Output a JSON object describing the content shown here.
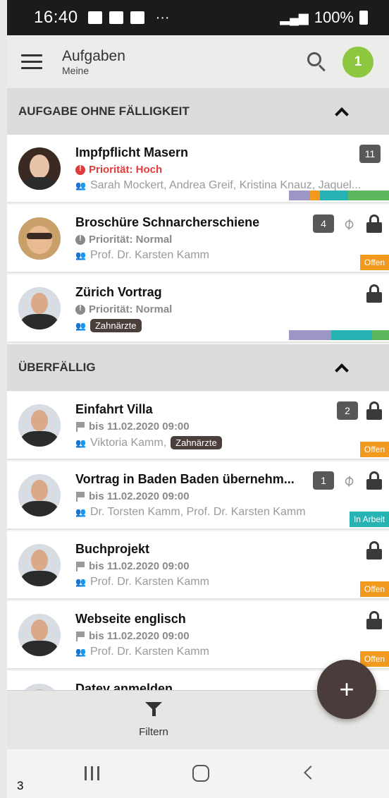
{
  "statusbar": {
    "time": "16:40",
    "dots": "···",
    "battery": "100%"
  },
  "appbar": {
    "title": "Aufgaben",
    "subtitle": "Meine",
    "user_badge": "1"
  },
  "sections": [
    {
      "title": "AUFGABE OHNE FÄLLIGKEIT"
    },
    {
      "title": "ÜBERFÄLLIG"
    }
  ],
  "tasks": [
    {
      "name": "Impfpflicht Masern",
      "meta": "Priorität: Hoch",
      "people": "Sarah Mockert, Andrea Greif, Kristina Knauz, Jaquel...",
      "count": "11"
    },
    {
      "name": "Broschüre Schnarcherschiene",
      "meta": "Priorität: Normal",
      "people": "Prof. Dr. Karsten Kamm",
      "count": "4",
      "status": "Offen"
    },
    {
      "name": "Zürich Vortrag",
      "meta": "Priorität: Normal",
      "tag": "Zahnärzte"
    },
    {
      "name": "Einfahrt Villa",
      "meta": "bis 11.02.2020 09:00",
      "people": "Viktoria Kamm,",
      "tag": "Zahnärzte",
      "count": "2",
      "status": "Offen"
    },
    {
      "name": "Vortrag in Baden Baden übernehm...",
      "meta": "bis 11.02.2020 09:00",
      "people": "Dr. Torsten Kamm, Prof. Dr. Karsten Kamm",
      "count": "1",
      "status": "In Arbeit"
    },
    {
      "name": "Buchprojekt",
      "meta": "bis 11.02.2020 09:00",
      "people": "Prof. Dr. Karsten Kamm",
      "status": "Offen"
    },
    {
      "name": "Webseite englisch",
      "meta": "bis 11.02.2020 09:00",
      "people": "Prof. Dr. Karsten Kamm",
      "status": "Offen"
    },
    {
      "name": "Datev anmelden"
    }
  ],
  "filter": {
    "label": "Filtern"
  },
  "fab": {
    "label": "+"
  },
  "page_number": "3",
  "colors": {
    "accent_green": "#8dc63f",
    "status_open": "#f29a1d",
    "status_work": "#27b3b3",
    "fab": "#4a3c3a",
    "priority_high": "#e23b3b"
  },
  "icons": [
    "hamburger-icon",
    "search-icon",
    "chevron-up-icon",
    "alert-icon",
    "flag-icon",
    "people-icon",
    "paperclip-icon",
    "lock-icon",
    "funnel-icon",
    "plus-icon",
    "recent-apps-icon",
    "home-icon",
    "back-icon"
  ]
}
